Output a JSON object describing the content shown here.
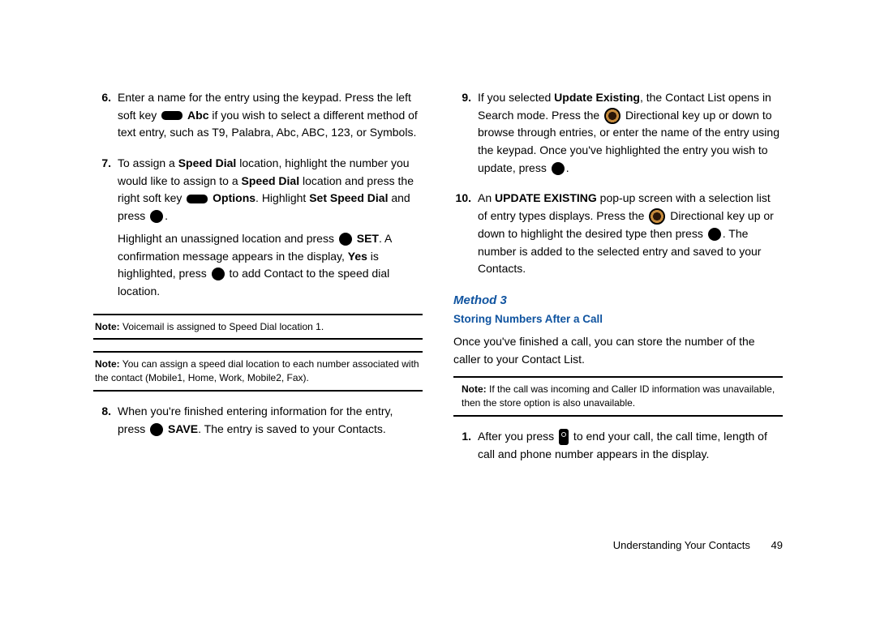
{
  "left": {
    "step6": {
      "num": "6.",
      "t1": "Enter a name for the entry using the keypad. Press the left soft key ",
      "t2_bold": "Abc",
      "t3": " if you wish to select a different method of text entry, such as T9, Palabra, Abc, ABC, 123, or Symbols."
    },
    "step7": {
      "num": "7.",
      "p1a": "To assign a ",
      "p1b_bold": "Speed Dial",
      "p1c": " location, highlight the number you would like to assign to a ",
      "p1d_bold": "Speed Dial",
      "p1e": " location and press the right soft key ",
      "p1f_bold": "Options",
      "p1g": ". Highlight ",
      "p1h_bold": "Set Speed Dial",
      "p1i": " and press ",
      "p1j": ".",
      "p2a": "Highlight an unassigned location and press ",
      "p2b_bold": "SET",
      "p2c": ". A confirmation message appears in the display, ",
      "p2d_bold": "Yes",
      "p2e": " is highlighted, press ",
      "p2f": " to add Contact to the speed dial location."
    },
    "note1": {
      "label": "Note:",
      "text": " Voicemail is assigned to Speed Dial location 1."
    },
    "note2": {
      "label": "Note:",
      "text": " You can assign a speed dial location to each number associated with the contact (Mobile1, Home, Work, Mobile2, Fax)."
    },
    "step8": {
      "num": "8.",
      "t1": "When you're finished entering information for the entry, press ",
      "t2_bold": "SAVE",
      "t3": ". The entry is saved to your Contacts."
    }
  },
  "right": {
    "step9": {
      "num": "9.",
      "t1": "If you selected ",
      "t2_bold": "Update Existing",
      "t3": ", the Contact List opens in Search mode. Press the ",
      "t4": " Directional key up or down to browse through entries, or enter the name of the entry using the keypad. Once you've highlighted the entry you wish to update, press ",
      "t5": "."
    },
    "step10": {
      "num": "10.",
      "t1": "An ",
      "t2_bold": "UPDATE EXISTING",
      "t3": " pop-up screen with a selection list of entry types displays. Press the ",
      "t4": " Directional key up or down to highlight the desired type then press ",
      "t5": ". The number is added to the selected entry and saved to your Contacts."
    },
    "method_title": "Method 3",
    "sub": "Storing Numbers After a Call",
    "intro": "Once you've finished a call, you can store the number of the caller to your Contact List.",
    "note3": {
      "label": "Note:",
      "text": " If the call was incoming and Caller ID information was unavailable, then the store option is also unavailable."
    },
    "step1": {
      "num": "1.",
      "t1": "After you press ",
      "t2": " to end your call, the call time, length of call and phone number appears in the display."
    }
  },
  "footer": {
    "section": "Understanding Your Contacts",
    "page": "49"
  }
}
